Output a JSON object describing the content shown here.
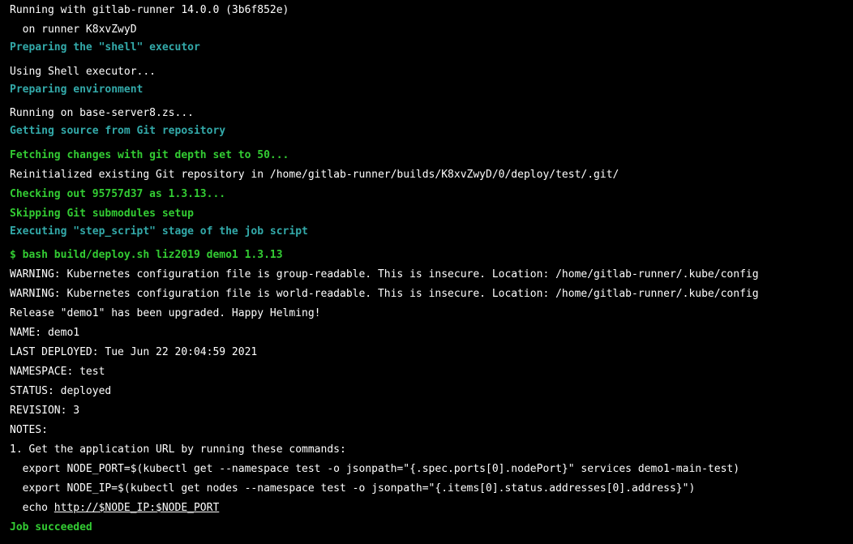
{
  "log": {
    "runner_version": "Running with gitlab-runner 14.0.0 (3b6f852e)",
    "runner_id": "  on runner K8xvZwyD",
    "section_prepare_executor": "Preparing the \"shell\" executor",
    "using_shell": "Using Shell executor...",
    "section_prepare_env": "Preparing environment",
    "running_on": "Running on base-server8.zs...",
    "section_get_source": "Getting source from Git repository",
    "fetching": "Fetching changes with git depth set to 50...",
    "reinit": "Reinitialized existing Git repository in /home/gitlab-runner/builds/K8xvZwyD/0/deploy/test/.git/",
    "checkout": "Checking out 95757d37 as 1.3.13...",
    "skip_submodules": "Skipping Git submodules setup",
    "section_step_script": "Executing \"step_script\" stage of the job script",
    "command": "$ bash build/deploy.sh liz2019 demo1 1.3.13",
    "warning_group": "WARNING: Kubernetes configuration file is group-readable. This is insecure. Location: /home/gitlab-runner/.kube/config",
    "warning_world": "WARNING: Kubernetes configuration file is world-readable. This is insecure. Location: /home/gitlab-runner/.kube/config",
    "release": "Release \"demo1\" has been upgraded. Happy Helming!",
    "name": "NAME: demo1",
    "last_deployed": "LAST DEPLOYED: Tue Jun 22 20:04:59 2021",
    "namespace": "NAMESPACE: test",
    "status": "STATUS: deployed",
    "revision": "REVISION: 3",
    "notes": "NOTES:",
    "notes_1": "1. Get the application URL by running these commands:",
    "export_port": "  export NODE_PORT=$(kubectl get --namespace test -o jsonpath=\"{.spec.ports[0].nodePort}\" services demo1-main-test)",
    "export_ip": "  export NODE_IP=$(kubectl get nodes --namespace test -o jsonpath=\"{.items[0].status.addresses[0].address}\")",
    "echo_prefix": "  echo ",
    "echo_url": "http://$NODE_IP:$NODE_PORT",
    "job_status": "Job succeeded"
  },
  "colors": {
    "background": "#000000",
    "text": "#ffffff",
    "section": "#33aaaa",
    "success": "#33cc33"
  }
}
